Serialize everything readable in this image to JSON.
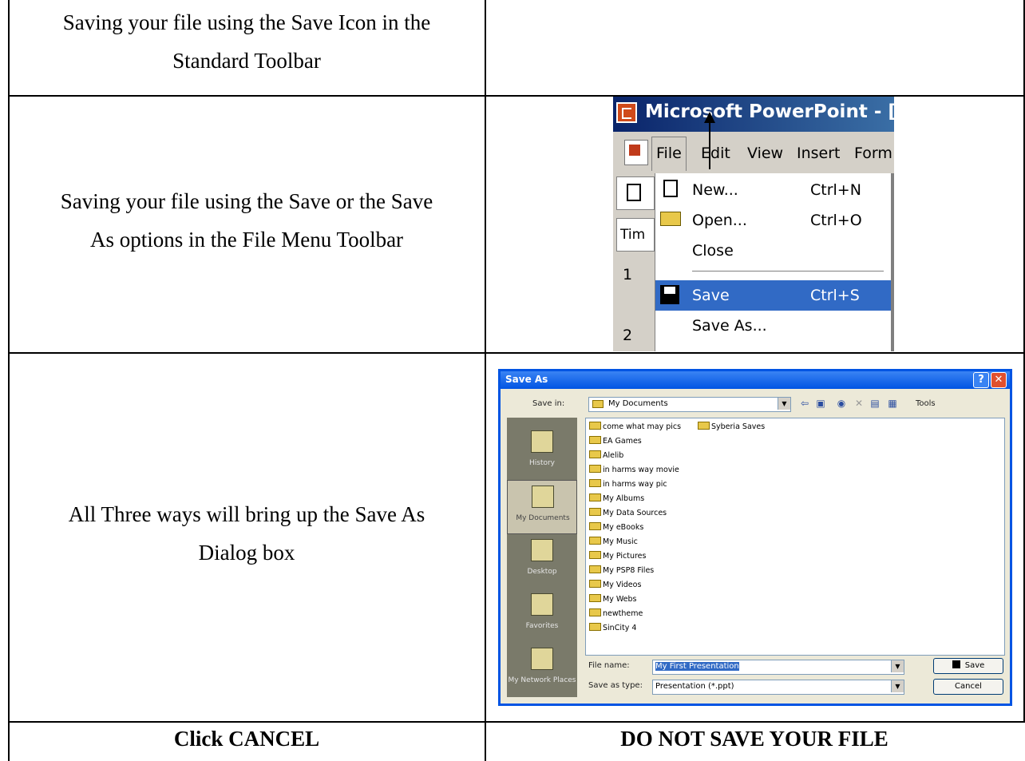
{
  "rows": [
    {
      "left": "Saving your file using the Save Icon in the Standard Toolbar"
    },
    {
      "left": "Saving your file using the Save or the Save As options in the File Menu Toolbar"
    },
    {
      "left": "All Three ways will bring up the Save As Dialog box"
    },
    {
      "left": "Click CANCEL",
      "right": "DO NOT SAVE YOUR FILE"
    }
  ],
  "row1_lines": [
    "Saving your file using the Save Icon in the",
    "Standard Toolbar"
  ],
  "row2_lines": [
    "Saving your file using the Save or the Save",
    "As options in the File Menu Toolbar"
  ],
  "row3_lines": [
    "All Three ways will bring up the Save As",
    "Dialog box"
  ],
  "powerpoint": {
    "title": "Microsoft PowerPoint - [P",
    "menu": [
      "File",
      "Edit",
      "View",
      "Insert",
      "Form"
    ],
    "left_labels": [
      "Tim",
      "1",
      "2"
    ],
    "file_menu": [
      {
        "label": "New...",
        "shortcut": "Ctrl+N",
        "icon": "new-doc-icon"
      },
      {
        "label": "Open...",
        "shortcut": "Ctrl+O",
        "icon": "open-folder-icon"
      },
      {
        "label": "Close",
        "shortcut": ""
      },
      {
        "label": "Save",
        "shortcut": "Ctrl+S",
        "icon": "floppy-disk-icon",
        "selected": true
      },
      {
        "label": "Save As...",
        "shortcut": ""
      }
    ]
  },
  "save_as": {
    "title": "Save As",
    "save_in_label": "Save in:",
    "save_in_value": "My Documents",
    "tools_label": "Tools",
    "places": [
      "History",
      "My Documents",
      "Desktop",
      "Favorites",
      "My Network Places"
    ],
    "files_col1": [
      "come what may pics",
      "EA Games",
      "Alelib",
      "in harms way movie",
      "in harms way pic",
      "My Albums",
      "My Data Sources",
      "My eBooks",
      "My Music",
      "My Pictures",
      "My PSP8 Files",
      "My Videos",
      "My Webs",
      "newtheme",
      "SinCity 4"
    ],
    "files_col2": [
      "Syberia Saves"
    ],
    "file_name_label": "File name:",
    "file_name_value": "My First Presentation",
    "save_type_label": "Save as type:",
    "save_type_value": "Presentation (*.ppt)",
    "save_button": "Save",
    "cancel_button": "Cancel"
  }
}
